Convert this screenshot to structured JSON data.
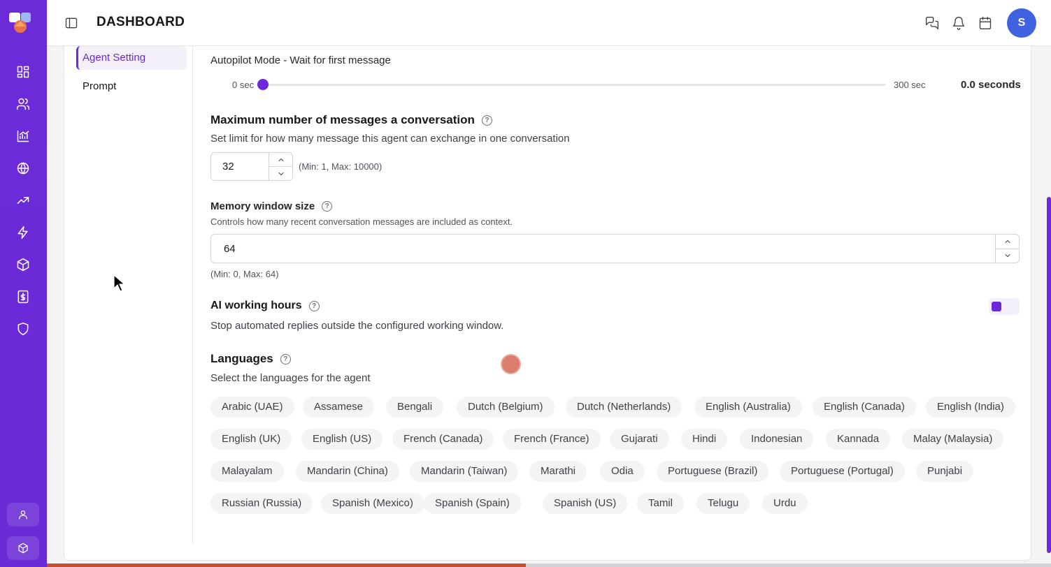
{
  "header": {
    "title": "DASHBOARD",
    "avatar_letter": "S"
  },
  "rail": {
    "icons": [
      "dashboard-icon",
      "users-icon",
      "analytics-icon",
      "globe-icon",
      "trending-icon",
      "lightning-icon",
      "package-icon",
      "billing-icon",
      "shield-icon"
    ],
    "bottom": [
      "profile-icon",
      "cube-icon"
    ]
  },
  "subnav": {
    "items": [
      {
        "label": "Agent Setting",
        "active": true
      },
      {
        "label": "Prompt",
        "active": false
      }
    ]
  },
  "autopilot": {
    "label": "Autopilot Mode - Wait for first message",
    "min": "0 sec",
    "max": "300 sec",
    "value_text": "0.0 seconds",
    "value": 0
  },
  "max_messages": {
    "title": "Maximum number of messages a conversation",
    "description": "Set limit for how many message this agent can exchange in one conversation",
    "value": "32",
    "hint": "(Min: 1, Max: 10000)"
  },
  "memory": {
    "title": "Memory window size",
    "description": "Controls how many recent conversation messages are included as context.",
    "value": "64",
    "hint": "(Min: 0, Max: 64)"
  },
  "working_hours": {
    "title": "AI working hours",
    "description": "Stop automated replies outside the configured working window."
  },
  "languages": {
    "title": "Languages",
    "description": "Select the languages for the agent",
    "items": [
      "Arabic (UAE)",
      "Assamese",
      "Bengali",
      "Dutch (Belgium)",
      "Dutch (Netherlands)",
      "English (Australia)",
      "English (Canada)",
      "English (India)",
      "English (UK)",
      "English (US)",
      "French (Canada)",
      "French (France)",
      "Gujarati",
      "Hindi",
      "Indonesian",
      "Kannada",
      "Malay (Malaysia)",
      "Malayalam",
      "Mandarin (China)",
      "Mandarin (Taiwan)",
      "Marathi",
      "Odia",
      "Portuguese (Brazil)",
      "Portuguese (Portugal)",
      "Punjabi",
      "Russian (Russia)",
      "Spanish (Mexico)",
      "Spanish (Spain)",
      "Spanish (US)",
      "Tamil",
      "Telugu",
      "Urdu"
    ]
  }
}
